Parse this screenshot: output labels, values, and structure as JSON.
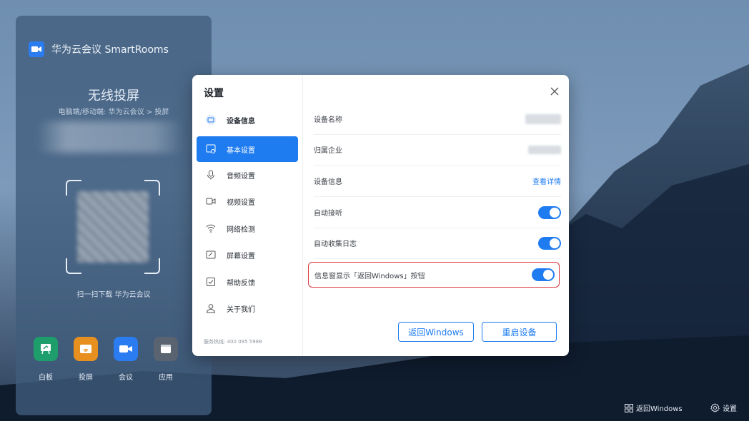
{
  "app": {
    "title": "华为云会议 SmartRooms"
  },
  "cast": {
    "title": "无线投屏",
    "subtitle": "电脑端/移动端: 华为云会议 > 投屏",
    "qr_caption": "扫一扫下载 华为云会议"
  },
  "dock": [
    {
      "label": "白板",
      "icon": "whiteboard-icon",
      "color": "#1e9e6b"
    },
    {
      "label": "投屏",
      "icon": "cast-icon",
      "color": "#e8901f"
    },
    {
      "label": "会议",
      "icon": "meeting-icon",
      "color": "#2b7cf0"
    },
    {
      "label": "应用",
      "icon": "apps-icon",
      "color": "#5a6470"
    }
  ],
  "settings": {
    "title": "设置",
    "nav": [
      {
        "label": "设备信息",
        "icon": "device-info-icon"
      },
      {
        "label": "基本设置",
        "icon": "basic-settings-icon"
      },
      {
        "label": "音频设置",
        "icon": "microphone-icon"
      },
      {
        "label": "视频设置",
        "icon": "camera-icon"
      },
      {
        "label": "网络检测",
        "icon": "wifi-icon"
      },
      {
        "label": "屏幕设置",
        "icon": "screen-icon"
      },
      {
        "label": "帮助反馈",
        "icon": "feedback-icon"
      },
      {
        "label": "关于我们",
        "icon": "user-icon"
      }
    ],
    "active_nav": "基本设置",
    "hotline": "服务热线: 400 095 5988",
    "rows": [
      {
        "label": "设备名称"
      },
      {
        "label": "归属企业"
      },
      {
        "label": "设备信息",
        "link": "查看详情"
      },
      {
        "label": "自动接听",
        "toggle": true
      },
      {
        "label": "自动收集日志",
        "toggle": true
      },
      {
        "label": "信息窗显示「返回Windows」按钮",
        "toggle": true
      }
    ],
    "buttons": {
      "back_windows": "返回Windows",
      "restart": "重启设备"
    }
  },
  "taskbar": {
    "back_windows": "返回Windows",
    "settings": "设置"
  },
  "colors": {
    "accent": "#1f7cf0",
    "highlight_border": "#d9363e"
  }
}
